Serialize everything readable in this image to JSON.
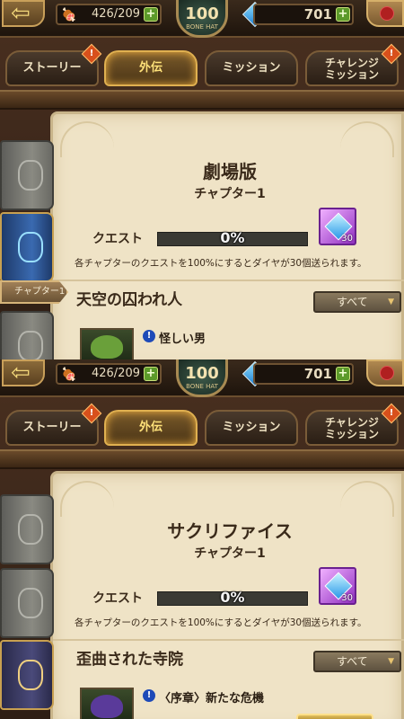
{
  "screens": [
    {
      "stamina": "426/209",
      "level": "100",
      "level_label": "BONE HAT",
      "gems": "701",
      "tabs": {
        "story": "ストーリー",
        "gaiden": "外伝",
        "mission": "ミッション",
        "challenge_1": "チャレンジ",
        "challenge_2": "ミッション"
      },
      "title": "劇場版",
      "chapter": "チャプター1",
      "quest_label": "クエスト",
      "progress_text": "0%",
      "progress_value": 0,
      "reward_count": "30",
      "note": "各チャプターのクエストを100%にするとダイヤが30個送られます。",
      "chapter_tag": "チャプター1",
      "subtitle": "天空の囚われ人",
      "filter": "すべて",
      "quest_name": "怪しい男"
    },
    {
      "stamina": "426/209",
      "level": "100",
      "level_label": "BONE HAT",
      "gems": "701",
      "tabs": {
        "story": "ストーリー",
        "gaiden": "外伝",
        "mission": "ミッション",
        "challenge_1": "チャレンジ",
        "challenge_2": "ミッション"
      },
      "title": "サクリファイス",
      "chapter": "チャプター1",
      "quest_label": "クエスト",
      "progress_text": "0%",
      "progress_value": 0,
      "reward_count": "30",
      "note": "各チャプターのクエストを100%にするとダイヤが30個送られます。",
      "subtitle": "歪曲された寺院",
      "filter": "すべて",
      "quest_name": "〈序章〉新たな危機"
    }
  ],
  "alert_mark": "!",
  "plus_mark": "+",
  "quest_alert_mark": "!",
  "colors": {
    "active_tab": "#ffe27a",
    "parchment": "#efe3c6",
    "progress_track": "#3a3a34"
  }
}
